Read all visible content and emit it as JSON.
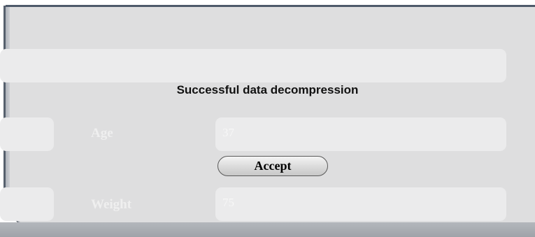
{
  "dialog": {
    "message": "Successful data decompression",
    "accept_label": "Accept"
  },
  "form": {
    "age_label": "Age",
    "age_value": "37",
    "weight_label": "Weight",
    "weight_value": "75"
  }
}
